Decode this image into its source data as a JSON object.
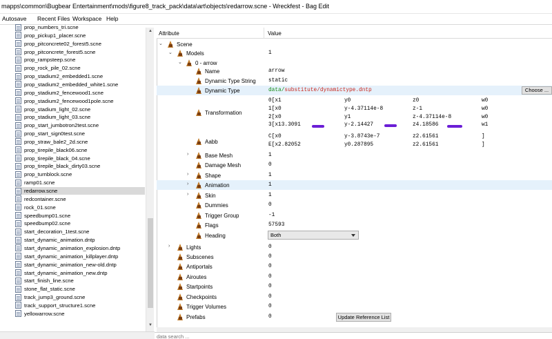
{
  "window": {
    "title": "mapps\\common\\Bugbear Entertainment\\mods\\figure8_track_pack\\data\\art\\objects\\redarrow.scne - Wreckfest - Bag Edit"
  },
  "menu": {
    "items": [
      "Autosave",
      "Recent Files",
      "Workspace",
      "Help"
    ]
  },
  "files": [
    "prop_numbers_tri.scne",
    "prop_pickup1_placer.scne",
    "prop_pitconcrete02_forest5.scne",
    "prop_pitconcrete_forest5.scne",
    "prop_rampsteep.scne",
    "prop_rock_pile_02.scne",
    "prop_stadium2_embedded1.scne",
    "prop_stadium2_embedded_white1.scne",
    "prop_stadium2_fencewood1.scne",
    "prop_stadium2_fencewood1pole.scne",
    "prop_stadium_light_02.scne",
    "prop_stadium_light_03.scne",
    "prop_start_jumbotron2test.scne",
    "prop_start_sign0test.scne",
    "prop_straw_bale2_2d.scne",
    "prop_tirepile_black06.scne",
    "prop_tirepile_black_04.scne",
    "prop_tirepile_black_dirty03.scne",
    "prop_turnblock.scne",
    "ramp01.scne",
    "redarrow.scne",
    "redcontainer.scne",
    "rock_01.scne",
    "speedbump01.scne",
    "speedbump02.scne",
    "start_decoration_1test.scne",
    "start_dynamic_animation.dntp",
    "start_dynamic_animation_explosion.dntp",
    "start_dynamic_animation_killplayer.dntp",
    "start_dynamic_animation_new-old.dntp",
    "start_dynamic_animation_new.dntp",
    "start_finish_line.scne",
    "stone_flat_static.scne",
    "track_jump3_ground.scne",
    "track_support_structure1.scne",
    "yellowarrow.scne"
  ],
  "selected_file": "redarrow.scne",
  "columns": {
    "attribute": "Attribute",
    "value": "Value"
  },
  "tree": {
    "scene": "Scene",
    "models": {
      "label": "Models",
      "value": "1"
    },
    "model0": "0 - arrow",
    "name": {
      "label": "Name",
      "value": "arrow"
    },
    "dyn_type_string": {
      "label": "Dynamic Type String",
      "value": "static"
    },
    "dyn_type": {
      "label": "Dynamic Type",
      "value_green": "data/",
      "value_red": "substitute/dynamictype.dntp",
      "button": "Choose ..."
    },
    "transformation": {
      "label": "Transformation",
      "rows": [
        [
          "0[x1",
          "y0",
          "z0",
          "w0"
        ],
        [
          "1[x0",
          "y-4.37114e-8",
          "z-1",
          "w0"
        ],
        [
          "2[x0",
          "y1",
          "z-4.37114e-8",
          "w0"
        ],
        [
          "3[x13.3091",
          "y-2.14427",
          "z4.18586",
          "w1"
        ]
      ]
    },
    "aabb": {
      "label": "Aabb",
      "rows": [
        [
          "C[x0",
          "y-3.8743e-7",
          "z2.61561",
          "]"
        ],
        [
          "E[x2.82052",
          "y0.287895",
          "z2.61561",
          "]"
        ]
      ]
    },
    "base_mesh": {
      "label": "Base Mesh",
      "value": "1"
    },
    "damage_mesh": {
      "label": "Damage Mesh",
      "value": "0"
    },
    "shape": {
      "label": "Shape",
      "value": "1"
    },
    "animation": {
      "label": "Animation",
      "value": "1"
    },
    "skin": {
      "label": "Skin",
      "value": "1"
    },
    "dummies": {
      "label": "Dummies",
      "value": "0"
    },
    "trigger_group": {
      "label": "Trigger Group",
      "value": "-1"
    },
    "flags": {
      "label": "Flags",
      "value": "57593"
    },
    "heading": {
      "label": "Heading",
      "value": "Both"
    },
    "lights": {
      "label": "Lights",
      "value": "0"
    },
    "subscenes": {
      "label": "Subscenes",
      "value": "0"
    },
    "antiportals": {
      "label": "Antiportals",
      "value": "0"
    },
    "airoutes": {
      "label": "Airoutes",
      "value": "0"
    },
    "startpoints": {
      "label": "Startpoints",
      "value": "0"
    },
    "checkpoints": {
      "label": "Checkpoints",
      "value": "0"
    },
    "trigger_volumes": {
      "label": "Trigger Volumes",
      "value": "0"
    },
    "prefabs": {
      "label": "Prefabs",
      "value": "0",
      "button": "Update Reference List"
    }
  },
  "search": {
    "placeholder": "data search ..."
  },
  "colors": {
    "selected_row": "#e5f1fb",
    "path_green": "#128a12",
    "path_red": "#c8281e",
    "scribble": "#6b1ed6"
  }
}
